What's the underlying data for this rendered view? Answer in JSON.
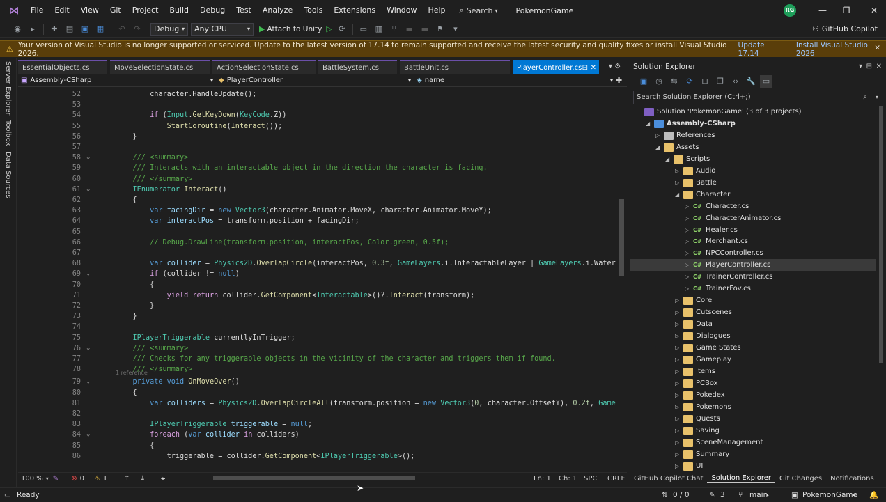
{
  "app": {
    "solution_name": "PokemonGame",
    "user_initials": "RG",
    "logo": "visual-studio-logo"
  },
  "menu": [
    "File",
    "Edit",
    "View",
    "Git",
    "Project",
    "Build",
    "Debug",
    "Test",
    "Analyze",
    "Tools",
    "Extensions",
    "Window",
    "Help"
  ],
  "search_label": "Search",
  "toolbar": {
    "config": "Debug",
    "platform": "Any CPU",
    "run_label": "Attach to Unity",
    "copilot_label": "GitHub Copilot"
  },
  "infobar": {
    "message": "Your version of Visual Studio is no longer supported or serviced. Update to the latest version of 17.14 to remain supported and receive the latest security and quality fixes or install Visual Studio 2026.",
    "link1": "Update 17.14",
    "link2": "Install Visual Studio 2026"
  },
  "side_tabs": [
    "Server Explorer",
    "Toolbox",
    "Data Sources"
  ],
  "editor_tabs": [
    "EssentialObjects.cs",
    "MoveSelectionState.cs",
    "ActionSelectionState.cs",
    "BattleSystem.cs",
    "BattleUnit.cs",
    "PlayerController.cs"
  ],
  "nav": {
    "project": "Assembly-CSharp",
    "class": "PlayerController",
    "member": "name"
  },
  "code": [
    {
      "n": "52",
      "tokens": [
        [
          "",
          "        character.HandleUpdate();"
        ]
      ]
    },
    {
      "n": "53",
      "tokens": [
        [
          "",
          ""
        ]
      ]
    },
    {
      "n": "54",
      "tokens": [
        [
          "",
          "        "
        ],
        [
          "kc",
          "if"
        ],
        [
          "",
          " ("
        ],
        [
          "t",
          "Input"
        ],
        [
          "",
          "."
        ],
        [
          "m",
          "GetKeyDown"
        ],
        [
          "",
          "("
        ],
        [
          "t",
          "KeyCode"
        ],
        [
          "",
          ".Z))"
        ]
      ]
    },
    {
      "n": "55",
      "tokens": [
        [
          "",
          "            "
        ],
        [
          "m",
          "StartCoroutine"
        ],
        [
          "",
          "("
        ],
        [
          "m",
          "Interact"
        ],
        [
          "",
          "());"
        ]
      ]
    },
    {
      "n": "56",
      "tokens": [
        [
          "",
          "    }"
        ]
      ]
    },
    {
      "n": "57",
      "tokens": [
        [
          "",
          ""
        ]
      ]
    },
    {
      "n": "58",
      "fold": true,
      "tokens": [
        [
          "c",
          "    /// <summary>"
        ]
      ]
    },
    {
      "n": "59",
      "tokens": [
        [
          "c",
          "    /// Interacts with an interactable object in the direction the character is facing."
        ]
      ]
    },
    {
      "n": "60",
      "tokens": [
        [
          "c",
          "    /// </summary>"
        ]
      ]
    },
    {
      "n": "61",
      "fold": true,
      "tokens": [
        [
          "",
          "    "
        ],
        [
          "t",
          "IEnumerator"
        ],
        [
          "",
          " "
        ],
        [
          "m",
          "Interact"
        ],
        [
          "",
          "()"
        ]
      ]
    },
    {
      "n": "62",
      "tokens": [
        [
          "",
          "    {"
        ]
      ]
    },
    {
      "n": "63",
      "tokens": [
        [
          "",
          "        "
        ],
        [
          "k",
          "var"
        ],
        [
          "",
          " "
        ],
        [
          "p",
          "facingDir"
        ],
        [
          "",
          " = "
        ],
        [
          "k",
          "new"
        ],
        [
          "",
          " "
        ],
        [
          "t",
          "Vector3"
        ],
        [
          "",
          "(character.Animator.MoveX, character.Animator.MoveY);"
        ]
      ]
    },
    {
      "n": "64",
      "tokens": [
        [
          "",
          "        "
        ],
        [
          "k",
          "var"
        ],
        [
          "",
          " "
        ],
        [
          "p",
          "interactPos"
        ],
        [
          "",
          " = transform.position + facingDir;"
        ]
      ]
    },
    {
      "n": "65",
      "tokens": [
        [
          "",
          ""
        ]
      ]
    },
    {
      "n": "66",
      "tokens": [
        [
          "c",
          "        // Debug.DrawLine(transform.position, interactPos, Color.green, 0.5f);"
        ]
      ]
    },
    {
      "n": "67",
      "tokens": [
        [
          "",
          ""
        ]
      ]
    },
    {
      "n": "68",
      "tokens": [
        [
          "",
          "        "
        ],
        [
          "k",
          "var"
        ],
        [
          "",
          " "
        ],
        [
          "p",
          "collider"
        ],
        [
          "",
          " = "
        ],
        [
          "t",
          "Physics2D"
        ],
        [
          "",
          "."
        ],
        [
          "m",
          "OverlapCircle"
        ],
        [
          "",
          "(interactPos, "
        ],
        [
          "n",
          "0.3f"
        ],
        [
          "",
          ", "
        ],
        [
          "t",
          "GameLayers"
        ],
        [
          "",
          ".i.InteractableLayer | "
        ],
        [
          "t",
          "GameLayers"
        ],
        [
          "",
          ".i.WaterL"
        ]
      ]
    },
    {
      "n": "69",
      "fold": true,
      "tokens": [
        [
          "",
          "        "
        ],
        [
          "kc",
          "if"
        ],
        [
          "",
          " (collider != "
        ],
        [
          "k",
          "null"
        ],
        [
          "",
          ")"
        ]
      ]
    },
    {
      "n": "70",
      "tokens": [
        [
          "",
          "        {"
        ]
      ]
    },
    {
      "n": "71",
      "tokens": [
        [
          "",
          "            "
        ],
        [
          "kc",
          "yield return"
        ],
        [
          "",
          " collider."
        ],
        [
          "m",
          "GetComponent"
        ],
        [
          "",
          "<"
        ],
        [
          "t",
          "Interactable"
        ],
        [
          "",
          ">()?."
        ],
        [
          "m",
          "Interact"
        ],
        [
          "",
          "(transform);"
        ]
      ]
    },
    {
      "n": "72",
      "tokens": [
        [
          "",
          "        }"
        ]
      ]
    },
    {
      "n": "73",
      "tokens": [
        [
          "",
          "    }"
        ]
      ]
    },
    {
      "n": "74",
      "tokens": [
        [
          "",
          ""
        ]
      ]
    },
    {
      "n": "75",
      "tokens": [
        [
          "",
          "    "
        ],
        [
          "t",
          "IPlayerTriggerable"
        ],
        [
          "",
          " currentlyInTrigger;"
        ]
      ]
    },
    {
      "n": "76",
      "fold": true,
      "tokens": [
        [
          "c",
          "    /// <summary>"
        ]
      ]
    },
    {
      "n": "77",
      "tokens": [
        [
          "c",
          "    /// Checks for any triggerable objects in the vicinity of the character and triggers them if found."
        ]
      ]
    },
    {
      "n": "78",
      "tokens": [
        [
          "c",
          "    /// </summary>"
        ]
      ]
    },
    {
      "n": "79",
      "fold": true,
      "ref": "1 reference",
      "tokens": [
        [
          "",
          "    "
        ],
        [
          "k",
          "private void"
        ],
        [
          "",
          " "
        ],
        [
          "m",
          "OnMoveOver"
        ],
        [
          "",
          "()"
        ]
      ]
    },
    {
      "n": "80",
      "tokens": [
        [
          "",
          "    {"
        ]
      ]
    },
    {
      "n": "81",
      "tokens": [
        [
          "",
          "        "
        ],
        [
          "k",
          "var"
        ],
        [
          "",
          " "
        ],
        [
          "p",
          "colliders"
        ],
        [
          "",
          " = "
        ],
        [
          "t",
          "Physics2D"
        ],
        [
          "",
          "."
        ],
        [
          "m",
          "OverlapCircleAll"
        ],
        [
          "",
          "(transform.position = "
        ],
        [
          "k",
          "new"
        ],
        [
          "",
          " "
        ],
        [
          "t",
          "Vector3"
        ],
        [
          "",
          "("
        ],
        [
          "n",
          "0"
        ],
        [
          "",
          ", character.OffsetY), "
        ],
        [
          "n",
          "0.2f"
        ],
        [
          "",
          ", "
        ],
        [
          "t",
          "GameL"
        ]
      ]
    },
    {
      "n": "82",
      "tokens": [
        [
          "",
          ""
        ]
      ]
    },
    {
      "n": "83",
      "tokens": [
        [
          "",
          "        "
        ],
        [
          "t",
          "IPlayerTriggerable"
        ],
        [
          "",
          " "
        ],
        [
          "p",
          "triggerable"
        ],
        [
          "",
          " = "
        ],
        [
          "k",
          "null"
        ],
        [
          "",
          ";"
        ]
      ]
    },
    {
      "n": "84",
      "fold": true,
      "tokens": [
        [
          "",
          "        "
        ],
        [
          "kc",
          "foreach"
        ],
        [
          "",
          " ("
        ],
        [
          "k",
          "var"
        ],
        [
          "",
          " "
        ],
        [
          "p",
          "collider"
        ],
        [
          "",
          " "
        ],
        [
          "kc",
          "in"
        ],
        [
          "",
          " colliders)"
        ]
      ]
    },
    {
      "n": "85",
      "tokens": [
        [
          "",
          "        {"
        ]
      ]
    },
    {
      "n": "86",
      "tokens": [
        [
          "",
          "            triggerable = collider."
        ],
        [
          "m",
          "GetComponent"
        ],
        [
          "",
          "<"
        ],
        [
          "t",
          "IPlayerTriggerable"
        ],
        [
          "",
          ">();"
        ]
      ]
    }
  ],
  "editor_status": {
    "zoom": "100 %",
    "errors": "0",
    "warnings": "1",
    "ln": "Ln: 1",
    "ch": "Ch: 1",
    "spc": "SPC",
    "crlf": "CRLF"
  },
  "solution_explorer": {
    "title": "Solution Explorer",
    "search_placeholder": "Search Solution Explorer (Ctrl+;)",
    "items": [
      {
        "label": "Solution 'PokemonGame' (3 of 3 projects)",
        "type": "sln",
        "depth": 0,
        "arrow": ""
      },
      {
        "label": "Assembly-CSharp",
        "type": "proj",
        "depth": 1,
        "arrow": "down",
        "bold": true
      },
      {
        "label": "References",
        "type": "refs",
        "depth": 2,
        "arrow": "right"
      },
      {
        "label": "Assets",
        "type": "folder",
        "depth": 2,
        "arrow": "down"
      },
      {
        "label": "Scripts",
        "type": "folder",
        "depth": 3,
        "arrow": "down"
      },
      {
        "label": "Audio",
        "type": "folder",
        "depth": 4,
        "arrow": "right"
      },
      {
        "label": "Battle",
        "type": "folder",
        "depth": 4,
        "arrow": "right"
      },
      {
        "label": "Character",
        "type": "folder",
        "depth": 4,
        "arrow": "down"
      },
      {
        "label": "Character.cs",
        "type": "cs",
        "depth": 5,
        "arrow": "right"
      },
      {
        "label": "CharacterAnimator.cs",
        "type": "cs",
        "depth": 5,
        "arrow": "right"
      },
      {
        "label": "Healer.cs",
        "type": "cs",
        "depth": 5,
        "arrow": "right"
      },
      {
        "label": "Merchant.cs",
        "type": "cs",
        "depth": 5,
        "arrow": "right"
      },
      {
        "label": "NPCController.cs",
        "type": "cs",
        "depth": 5,
        "arrow": "right"
      },
      {
        "label": "PlayerController.cs",
        "type": "cs",
        "depth": 5,
        "arrow": "right",
        "selected": true
      },
      {
        "label": "TrainerController.cs",
        "type": "cs",
        "depth": 5,
        "arrow": "right"
      },
      {
        "label": "TrainerFov.cs",
        "type": "cs",
        "depth": 5,
        "arrow": "right"
      },
      {
        "label": "Core",
        "type": "folder",
        "depth": 4,
        "arrow": "right"
      },
      {
        "label": "Cutscenes",
        "type": "folder",
        "depth": 4,
        "arrow": "right"
      },
      {
        "label": "Data",
        "type": "folder",
        "depth": 4,
        "arrow": "right"
      },
      {
        "label": "Dialogues",
        "type": "folder",
        "depth": 4,
        "arrow": "right"
      },
      {
        "label": "Game States",
        "type": "folder",
        "depth": 4,
        "arrow": "right"
      },
      {
        "label": "Gameplay",
        "type": "folder",
        "depth": 4,
        "arrow": "right"
      },
      {
        "label": "Items",
        "type": "folder",
        "depth": 4,
        "arrow": "right"
      },
      {
        "label": "PCBox",
        "type": "folder",
        "depth": 4,
        "arrow": "right"
      },
      {
        "label": "Pokedex",
        "type": "folder",
        "depth": 4,
        "arrow": "right"
      },
      {
        "label": "Pokemons",
        "type": "folder",
        "depth": 4,
        "arrow": "right"
      },
      {
        "label": "Quests",
        "type": "folder",
        "depth": 4,
        "arrow": "right"
      },
      {
        "label": "Saving",
        "type": "folder",
        "depth": 4,
        "arrow": "right"
      },
      {
        "label": "SceneManagement",
        "type": "folder",
        "depth": 4,
        "arrow": "right"
      },
      {
        "label": "Summary",
        "type": "folder",
        "depth": 4,
        "arrow": "right"
      },
      {
        "label": "UI",
        "type": "folder",
        "depth": 4,
        "arrow": "right"
      }
    ]
  },
  "bottom_tabs": [
    "GitHub Copilot Chat",
    "Solution Explorer",
    "Git Changes",
    "Notifications"
  ],
  "status": {
    "ready": "Ready",
    "updown": "0 / 0",
    "pencil_count": "3",
    "branch": "main",
    "repo": "PokemonGame"
  },
  "colors": {
    "accent": "#0078d4",
    "infobar": "#5a3e0a",
    "tab_border": "#6b4fa8"
  }
}
